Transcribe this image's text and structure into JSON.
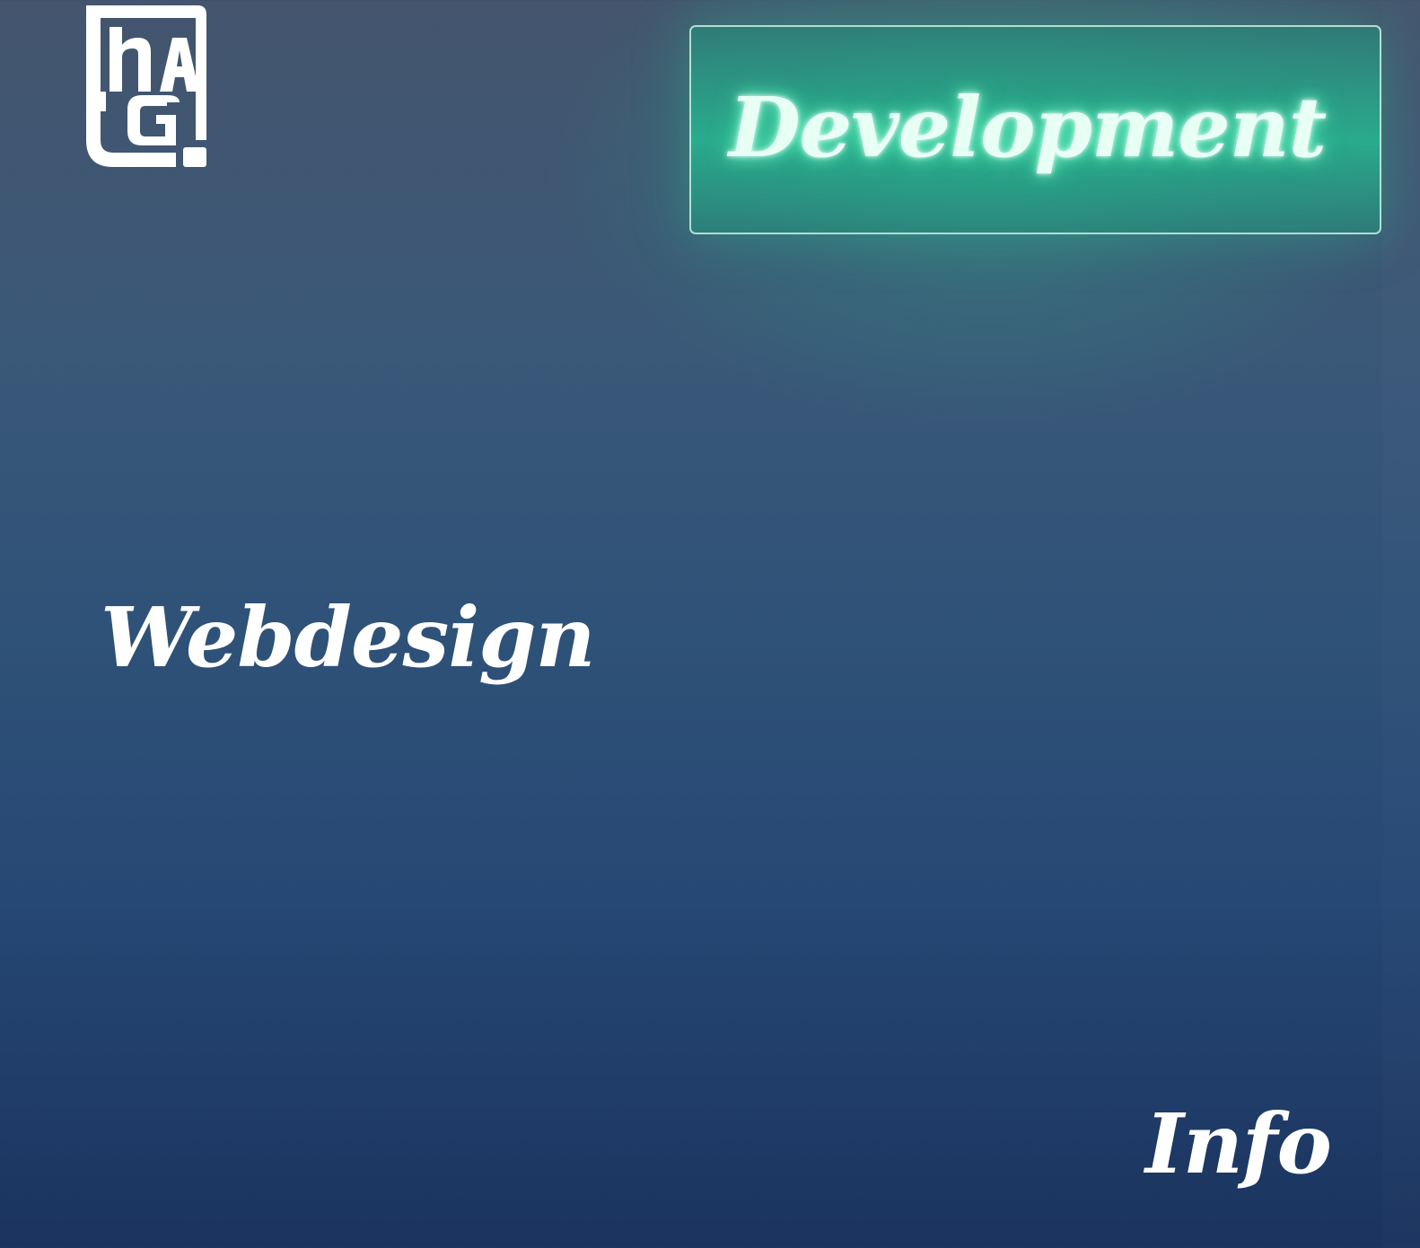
{
  "brand": {
    "logo_icon": "hag-monogram-logo",
    "logo_text": "HAG"
  },
  "nav": {
    "development": "Development",
    "webdesign": "Webdesign",
    "info": "Info"
  },
  "colors": {
    "background_top": "#44556d",
    "background_bottom": "#1b335f",
    "active_accent": "#2bbf94",
    "text": "#ffffff"
  }
}
